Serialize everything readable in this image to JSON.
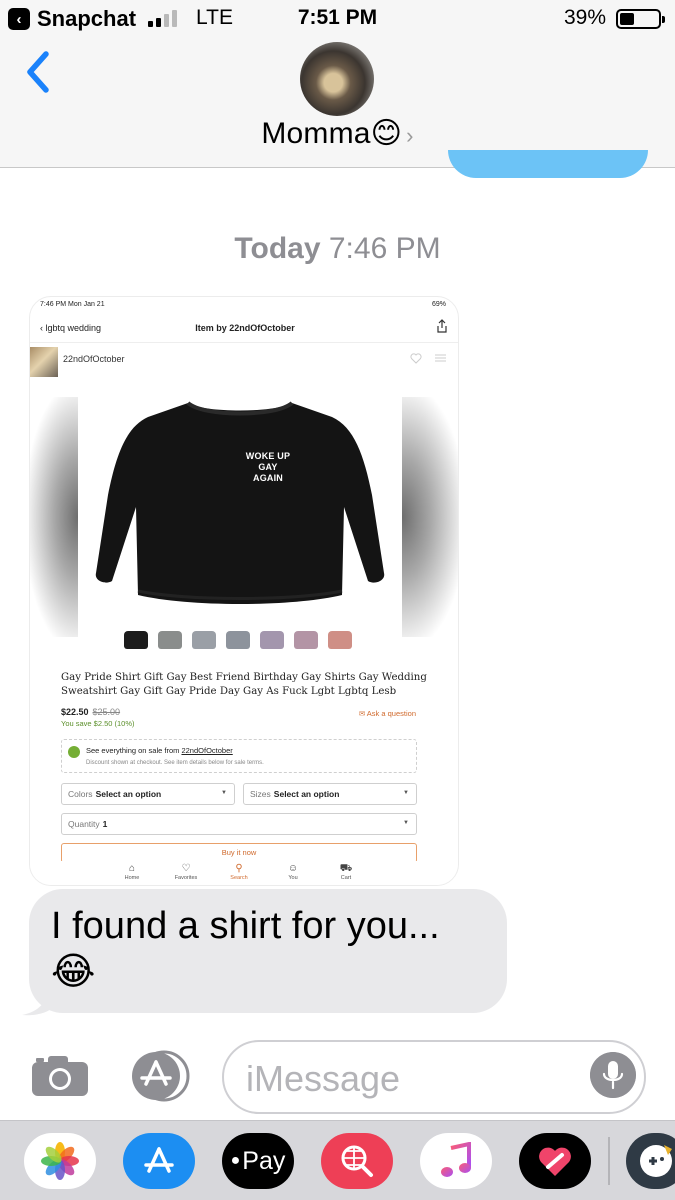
{
  "status_bar": {
    "back_app": "Snapchat",
    "carrier": "LTE",
    "time": "7:51 PM",
    "battery_percent": "39%",
    "signal_bars_on": 2,
    "signal_bars_total": 4,
    "battery_level": 0.39
  },
  "header": {
    "contact_name": "Momma😊",
    "details_chevron": "›"
  },
  "thread": {
    "timestamp_day": "Today",
    "timestamp_time": "7:46 PM",
    "text_message": "I found a shirt for you... 😂"
  },
  "screenshot": {
    "status_time": "7:46 PM  Mon Jan 21",
    "status_battery": "69%",
    "nav_back": "lgbtq wedding",
    "nav_title": "Item by 22ndOfOctober",
    "shop_name": "22ndOfOctober",
    "print_text": [
      "WOKE UP",
      "GAY",
      "AGAIN"
    ],
    "swatch_colors": [
      "#1c1c1c",
      "#8a8d8c",
      "#9a9fa6",
      "#8d939c",
      "#a396ad",
      "#b394a5",
      "#cf8f86"
    ],
    "product_title": "Gay Pride Shirt Gift Gay Best Friend Birthday Gay Shirts Gay Wedding Sweatshirt Gay Gift Gay Pride Day Gay As Fuck Lgbt Lgbtq Lesb",
    "price": "$22.50",
    "original_price": "$25.00",
    "savings": "You save $2.50 (10%)",
    "ask_question": "Ask a question",
    "sale_line_prefix": "See everything on sale from ",
    "sale_line_link": "22ndOfOctober",
    "sale_note": "Discount shown at checkout. See item details below for sale terms.",
    "colors_label": "Colors",
    "colors_value": "Select an option",
    "sizes_label": "Sizes",
    "sizes_value": "Select an option",
    "quantity_label": "Quantity",
    "quantity_value": "1",
    "buy_now": "Buy it now",
    "tabs": [
      "Home",
      "Favorites",
      "Search",
      "You",
      "Cart"
    ]
  },
  "input": {
    "placeholder": "iMessage"
  },
  "app_drawer": {
    "apps": [
      "photos-app",
      "app-store-app",
      "apple-pay-app",
      "images-search-app",
      "music-app",
      "digital-touch-app",
      "game-app"
    ],
    "apple_pay_label": "Pay"
  },
  "colors": {
    "accent_blue": "#1a82fb",
    "bubble_gray": "#e9e9eb",
    "etsy_orange": "#d06a2d"
  }
}
